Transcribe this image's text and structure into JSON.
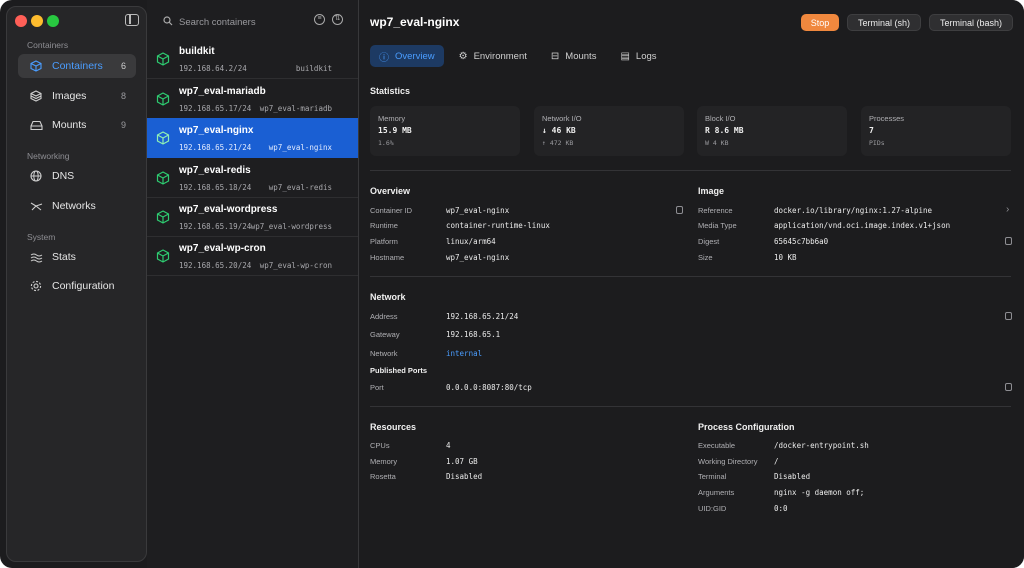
{
  "sidebar": {
    "sections": {
      "containers": "Containers",
      "networking": "Networking",
      "system": "System"
    },
    "items": [
      {
        "label": "Containers",
        "count": "6",
        "icon": "cube-icon"
      },
      {
        "label": "Images",
        "count": "8",
        "icon": "images-icon"
      },
      {
        "label": "Mounts",
        "count": "9",
        "icon": "drive-icon"
      },
      {
        "label": "DNS",
        "icon": "globe-icon"
      },
      {
        "label": "Networks",
        "icon": "network-icon"
      },
      {
        "label": "Stats",
        "icon": "waves-icon"
      },
      {
        "label": "Configuration",
        "icon": "gear-icon"
      }
    ]
  },
  "list": {
    "search_placeholder": "Search containers",
    "containers": [
      {
        "name": "buildkit",
        "ip": "192.168.64.2/24",
        "tag": "buildkit"
      },
      {
        "name": "wp7_eval-mariadb",
        "ip": "192.168.65.17/24",
        "tag": "wp7_eval-mariadb"
      },
      {
        "name": "wp7_eval-nginx",
        "ip": "192.168.65.21/24",
        "tag": "wp7_eval-nginx"
      },
      {
        "name": "wp7_eval-redis",
        "ip": "192.168.65.18/24",
        "tag": "wp7_eval-redis"
      },
      {
        "name": "wp7_eval-wordpress",
        "ip": "192.168.65.19/24",
        "tag": "wp7_eval-wordpress"
      },
      {
        "name": "wp7_eval-wp-cron",
        "ip": "192.168.65.20/24",
        "tag": "wp7_eval-wp-cron"
      }
    ]
  },
  "header": {
    "title": "wp7_eval-nginx",
    "stop": "Stop",
    "term_sh": "Terminal (sh)",
    "term_bash": "Terminal (bash)"
  },
  "tabs": [
    "Overview",
    "Environment",
    "Mounts",
    "Logs"
  ],
  "statistics": {
    "title": "Statistics",
    "cards": [
      {
        "label": "Memory",
        "value": "15.9 MB",
        "sub": "1.6%"
      },
      {
        "label": "Network I/O",
        "value": "↓ 46 KB",
        "sub": "↑ 472 KB"
      },
      {
        "label": "Block I/O",
        "value": "R 8.6 MB",
        "sub": "W 4 KB"
      },
      {
        "label": "Processes",
        "value": "7",
        "sub": "PIDs"
      }
    ]
  },
  "overview": {
    "title": "Overview",
    "rows": [
      {
        "k": "Container ID",
        "v": "wp7_eval-nginx"
      },
      {
        "k": "Runtime",
        "v": "container-runtime-linux"
      },
      {
        "k": "Platform",
        "v": "linux/arm64"
      },
      {
        "k": "Hostname",
        "v": "wp7_eval-nginx"
      }
    ]
  },
  "image": {
    "title": "Image",
    "rows": [
      {
        "k": "Reference",
        "v": "docker.io/library/nginx:1.27-alpine"
      },
      {
        "k": "Media Type",
        "v": "application/vnd.oci.image.index.v1+json"
      },
      {
        "k": "Digest",
        "v": "65645c7bb6a0"
      },
      {
        "k": "Size",
        "v": "10 KB"
      }
    ]
  },
  "network": {
    "title": "Network",
    "rows": [
      {
        "k": "Address",
        "v": "192.168.65.21/24"
      },
      {
        "k": "Gateway",
        "v": "192.168.65.1"
      },
      {
        "k": "Network",
        "v": "internal"
      }
    ],
    "published_title": "Published Ports",
    "port": {
      "k": "Port",
      "v": "0.0.0.0:8087:80/tcp"
    }
  },
  "resources": {
    "title": "Resources",
    "rows": [
      {
        "k": "CPUs",
        "v": "4"
      },
      {
        "k": "Memory",
        "v": "1.07 GB"
      },
      {
        "k": "Rosetta",
        "v": "Disabled"
      }
    ]
  },
  "process": {
    "title": "Process Configuration",
    "rows": [
      {
        "k": "Executable",
        "v": "/docker-entrypoint.sh"
      },
      {
        "k": "Working Directory",
        "v": "/"
      },
      {
        "k": "Terminal",
        "v": "Disabled"
      },
      {
        "k": "Arguments",
        "v": "nginx -g daemon off;"
      },
      {
        "k": "UID:GID",
        "v": "0:0"
      }
    ]
  },
  "colors": {
    "accent": "#4a9dff",
    "selection": "#1a5fd3",
    "stop": "#f0883e"
  }
}
